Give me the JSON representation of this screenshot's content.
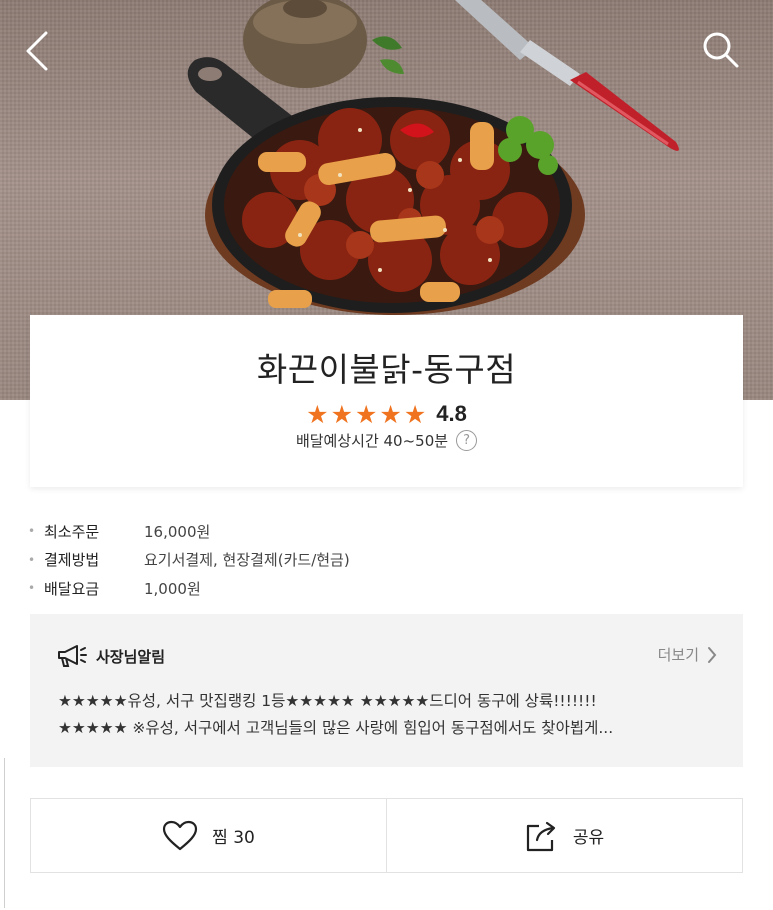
{
  "hero": {
    "back_icon": "chevron-left-icon",
    "search_icon": "search-icon"
  },
  "store": {
    "name": "화끈이불닭-동구점",
    "rating": "4.8",
    "stars": 5,
    "star_color": "#f0731f",
    "delivery_time": "배달예상시간 40~50분",
    "help_icon_text": "?"
  },
  "info": [
    {
      "label": "최소주문",
      "value": "16,000원"
    },
    {
      "label": "결제방법",
      "value": "요기서결제, 현장결제(카드/현금)"
    },
    {
      "label": "배달요금",
      "value": "1,000원"
    }
  ],
  "notice": {
    "icon": "megaphone-icon",
    "title": "사장님알림",
    "more_label": "더보기",
    "line1": "★★★★★유성, 서구 맛집랭킹 1등★★★★★ ★★★★★드디어 동구에 상륙!!!!!!!",
    "line2": "★★★★★ ※유성, 서구에서 고객님들의 많은 사랑에 힘입어 동구점에서도 찾아뵙게..."
  },
  "actions": {
    "like_label": "찜 30",
    "share_label": "공유"
  }
}
